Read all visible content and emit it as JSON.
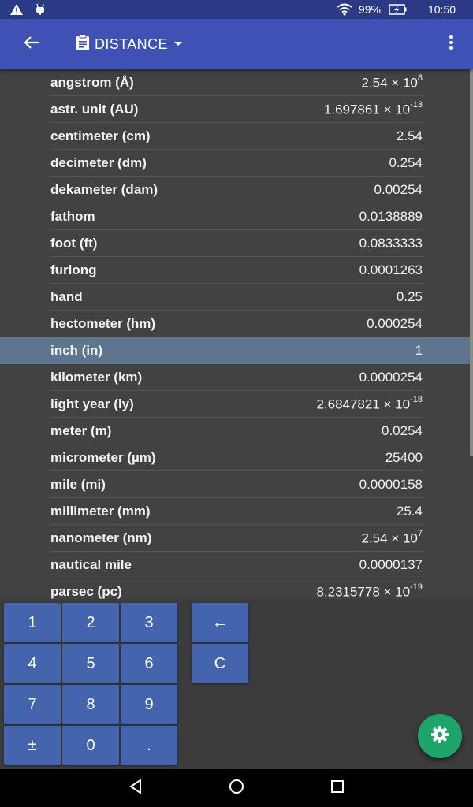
{
  "status_bar": {
    "battery": "99%",
    "time": "10:50",
    "icons": [
      "warning-icon",
      "android-debug-icon",
      "wifi-icon",
      "battery-charging-icon"
    ]
  },
  "app_bar": {
    "title": "DISTANCE",
    "icons": [
      "back-arrow-icon",
      "clipboard-icon",
      "dropdown-arrow-icon",
      "more-vert-icon"
    ]
  },
  "units": [
    {
      "name": "angstrom (Å)",
      "mantissa": "2.54 × 10",
      "exp": "8"
    },
    {
      "name": "astr. unit (AU)",
      "mantissa": "1.697861 × 10",
      "exp": "-13"
    },
    {
      "name": "centimeter (cm)",
      "mantissa": "2.54",
      "exp": ""
    },
    {
      "name": "decimeter (dm)",
      "mantissa": "0.254",
      "exp": ""
    },
    {
      "name": "dekameter (dam)",
      "mantissa": "0.00254",
      "exp": ""
    },
    {
      "name": "fathom",
      "mantissa": "0.0138889",
      "exp": ""
    },
    {
      "name": "foot (ft)",
      "mantissa": "0.0833333",
      "exp": ""
    },
    {
      "name": "furlong",
      "mantissa": "0.0001263",
      "exp": ""
    },
    {
      "name": "hand",
      "mantissa": "0.25",
      "exp": ""
    },
    {
      "name": "hectometer (hm)",
      "mantissa": "0.000254",
      "exp": ""
    },
    {
      "name": "inch (in)",
      "mantissa": "1",
      "exp": ""
    },
    {
      "name": "kilometer (km)",
      "mantissa": "0.0000254",
      "exp": ""
    },
    {
      "name": "light year (ly)",
      "mantissa": "2.6847821 × 10",
      "exp": "-18"
    },
    {
      "name": "meter (m)",
      "mantissa": "0.0254",
      "exp": ""
    },
    {
      "name": "micrometer (µm)",
      "mantissa": "25400",
      "exp": ""
    },
    {
      "name": "mile (mi)",
      "mantissa": "0.0000158",
      "exp": ""
    },
    {
      "name": "millimeter (mm)",
      "mantissa": "25.4",
      "exp": ""
    },
    {
      "name": "nanometer (nm)",
      "mantissa": "2.54 × 10",
      "exp": "7"
    },
    {
      "name": "nautical mile",
      "mantissa": "0.0000137",
      "exp": ""
    },
    {
      "name": "parsec (pc)",
      "mantissa": "8.2315778 × 10",
      "exp": "-19"
    }
  ],
  "selected_unit": "inch (in)",
  "keypad": {
    "digits": [
      "1",
      "2",
      "3",
      "4",
      "5",
      "6",
      "7",
      "8",
      "9",
      "±",
      "0",
      "."
    ],
    "backspace": "←",
    "clear": "C"
  },
  "fab": {
    "icon": "settings-gear-icon"
  },
  "nav_bar": {
    "icons": [
      "nav-back-icon",
      "nav-home-icon",
      "nav-recents-icon"
    ]
  },
  "colors": {
    "status_bar": "#2a3a86",
    "app_bar": "#3f51b5",
    "list_bg": "#424242",
    "selected_row": "#5e7590",
    "key": "#4464ae",
    "fab": "#1ea66a"
  }
}
